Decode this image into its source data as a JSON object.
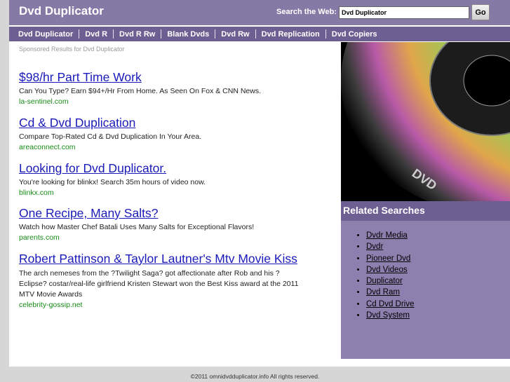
{
  "header": {
    "title": "Dvd Duplicator",
    "search_label": "Search the Web:",
    "search_value": "Dvd Duplicator",
    "go_label": "Go"
  },
  "nav": {
    "items": [
      "Dvd Duplicator",
      "Dvd R",
      "Dvd R Rw",
      "Blank Dvds",
      "Dvd Rw",
      "Dvd Replication",
      "Dvd Copiers"
    ]
  },
  "sponsored_label": "Sponsored Results for Dvd Duplicator",
  "ads": [
    {
      "title": "$98/hr Part Time Work",
      "desc": "Can You Type? Earn $94+/Hr From Home. As Seen On Fox & CNN News.",
      "url": "la-sentinel.com"
    },
    {
      "title": "Cd & Dvd Duplication",
      "desc": "Compare Top-Rated Cd & Dvd Duplication In Your Area.",
      "url": "areaconnect.com"
    },
    {
      "title": "Looking for Dvd Duplicator.",
      "desc": "You're looking for blinkx! Search 35m hours of video now.",
      "url": "blinkx.com"
    },
    {
      "title": "One Recipe, Many Salts?",
      "desc": "Watch how Master Chef Batali Uses Many Salts for Exceptional Flavors!",
      "url": "parents.com"
    },
    {
      "title": "Robert Pattinson & Taylor Lautner's Mtv Movie Kiss",
      "desc": "The arch nemeses from the ?Twilight Saga? got affectionate after Rob and his ? Eclipse? costar/real-life girlfriend Kristen Stewart won the Best Kiss award at the 2011 MTV Movie Awards",
      "url": "celebrity-gossip.net"
    }
  ],
  "sidebar": {
    "image_text": "DVD",
    "related_title": "Related Searches",
    "related": [
      "Dvdr Media",
      "Dvdr",
      "Pioneer Dvd",
      "Dvd Videos",
      "Duplicator",
      "Dvd Ram",
      "Cd Dvd Drive",
      "Dvd System"
    ]
  },
  "footer": "©2011 omnidvdduplicator.info All rights reserved.",
  "colors": {
    "header": "#857aa5",
    "nav": "#6d5f92",
    "sidebar": "#8d7fae",
    "link": "#1a1aba",
    "url": "#168a16"
  }
}
